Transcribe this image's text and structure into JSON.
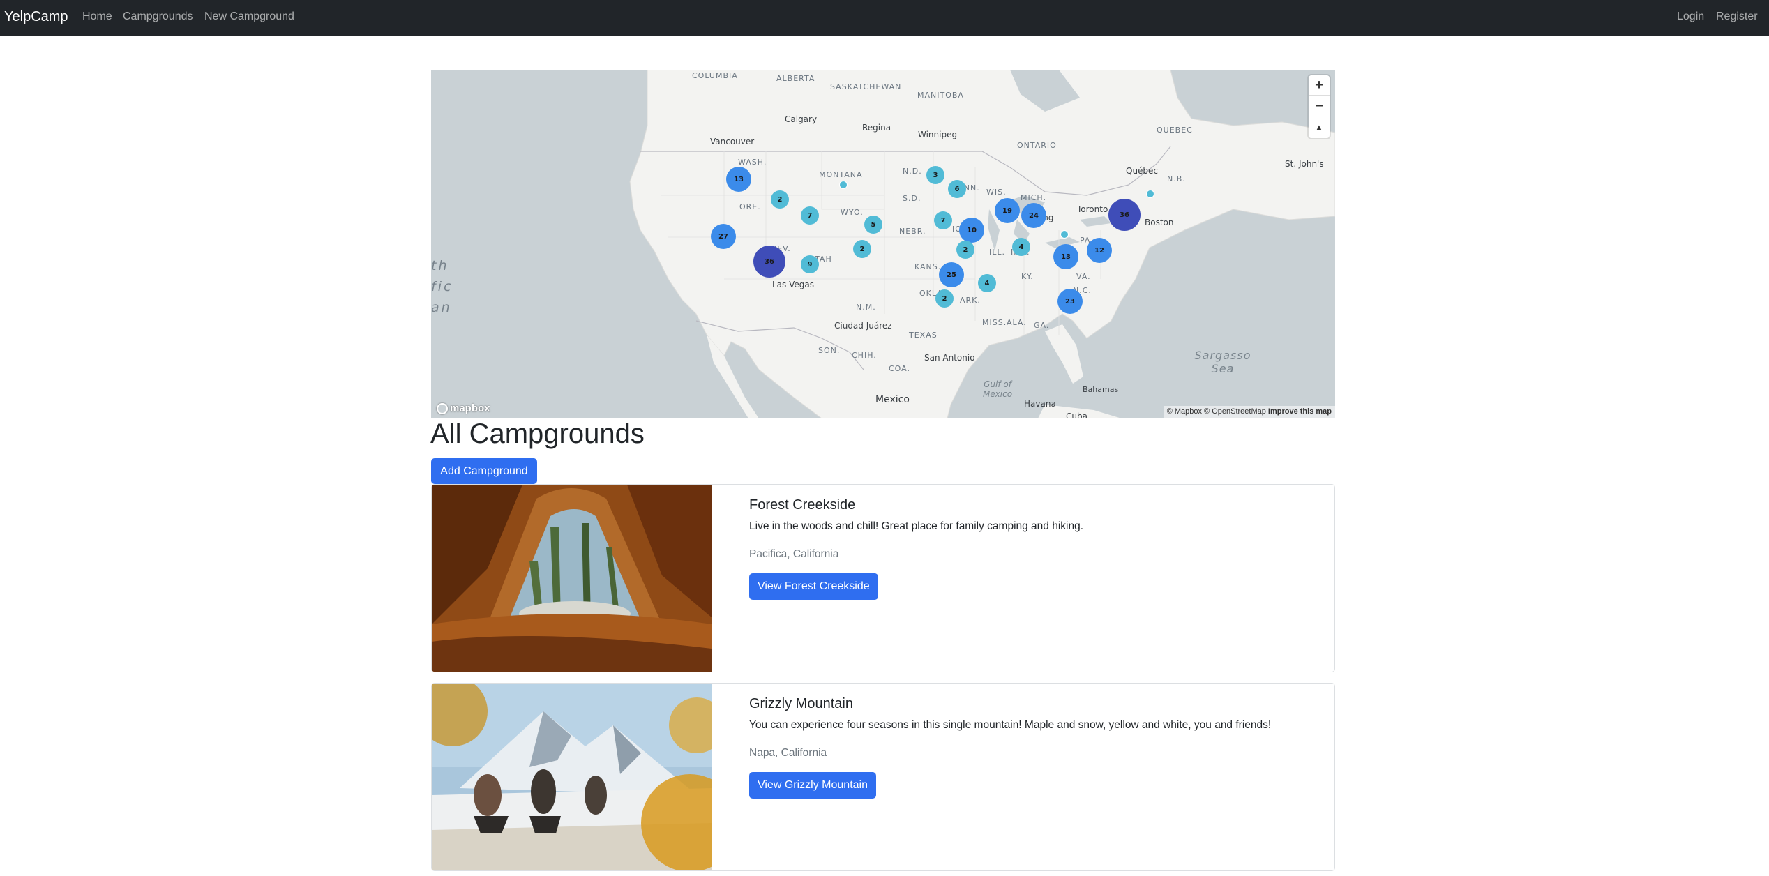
{
  "navbar": {
    "brand": "YelpCamp",
    "links": [
      "Home",
      "Campgrounds",
      "New Campground"
    ],
    "login": "Login",
    "register": "Register"
  },
  "map": {
    "labels": {
      "columbia": "COLUMBIA",
      "alberta": "ALBERTA",
      "saskatchewan": "SASKATCHEWAN",
      "manitoba": "MANITOBA",
      "ontario": "ONTARIO",
      "quebec_region": "QUEBEC",
      "calgary": "Calgary",
      "regina": "Regina",
      "winnipeg": "Winnipeg",
      "vancouver": "Vancouver",
      "wash": "WASH.",
      "montana": "MONTANA",
      "nd": "N.D.",
      "ore": "ORE.",
      "wyo": "WYO.",
      "sd": "S.D.",
      "minn": "MINN.",
      "wis": "WIS.",
      "mich": "MICH.",
      "quebec_city": "Québec",
      "nb": "N.B.",
      "st_johns": "St. John's",
      "toronto": "Toronto",
      "boston": "Boston",
      "lansing": "Lansing",
      "nev": "NEV.",
      "utah": "UTAH",
      "nebr": "NEBR.",
      "iowa": "IOWA",
      "ill": "ILL.",
      "ind": "IND.",
      "pa": "PA.",
      "kans": "KANS.",
      "ky": "KY.",
      "va": "VA.",
      "las_vegas": "Las Vegas",
      "nm": "N.M.",
      "okla": "OKLA.",
      "ark": "ARK.",
      "nc": "N.C.",
      "ciudad_juarez": "Ciudad Juárez",
      "miss": "MISS.",
      "ala": "ALA.",
      "ga": "GA.",
      "texas": "TEXAS",
      "son": "SON.",
      "chih": "CHIH.",
      "san_antonio": "San Antonio",
      "coa": "COA.",
      "mexico": "Mexico",
      "gulf": "Gulf of Mexico",
      "havana": "Havana",
      "cuba": "Cuba",
      "bahamas": "Bahamas",
      "sargasso": "Sargasso Sea",
      "pacific_1": "th",
      "pacific_2": "fic",
      "pacific_3": "an"
    },
    "clusters": [
      {
        "count": "13",
        "tier": "mid"
      },
      {
        "count": "2",
        "tier": "small"
      },
      {
        "count": "7",
        "tier": "small"
      },
      {
        "count": "",
        "tier": "point"
      },
      {
        "count": "27",
        "tier": "mid"
      },
      {
        "count": "36",
        "tier": "large"
      },
      {
        "count": "9",
        "tier": "small"
      },
      {
        "count": "5",
        "tier": "small"
      },
      {
        "count": "2",
        "tier": "small"
      },
      {
        "count": "3",
        "tier": "small"
      },
      {
        "count": "6",
        "tier": "small"
      },
      {
        "count": "7",
        "tier": "small"
      },
      {
        "count": "10",
        "tier": "mid"
      },
      {
        "count": "2",
        "tier": "small"
      },
      {
        "count": "19",
        "tier": "mid"
      },
      {
        "count": "24",
        "tier": "mid"
      },
      {
        "count": "4",
        "tier": "small"
      },
      {
        "count": "",
        "tier": "point"
      },
      {
        "count": "13",
        "tier": "mid"
      },
      {
        "count": "12",
        "tier": "mid"
      },
      {
        "count": "36",
        "tier": "large"
      },
      {
        "count": "",
        "tier": "point"
      },
      {
        "count": "25",
        "tier": "mid"
      },
      {
        "count": "4",
        "tier": "small"
      },
      {
        "count": "2",
        "tier": "small"
      },
      {
        "count": "23",
        "tier": "mid"
      }
    ],
    "zoom_in": "+",
    "zoom_out": "−",
    "compass": "▲",
    "logo": "mapbox",
    "attribution": "© Mapbox © OpenStreetMap",
    "improve": "Improve this map"
  },
  "colors": {
    "navbar_bg": "#212529",
    "primary": "#2f6ef0",
    "cluster_small": "#51bbd6",
    "cluster_mid": "#3b8bea",
    "cluster_large": "#3f4db8"
  },
  "main": {
    "title": "All Campgrounds",
    "add_button": "Add Campground"
  },
  "campgrounds": [
    {
      "title": "Forest Creekside",
      "description": "Live in the woods and chill! Great place for family camping and hiking.",
      "location": "Pacifica, California",
      "button": "View Forest Creekside"
    },
    {
      "title": "Grizzly Mountain",
      "description": "You can experience four seasons in this single mountain! Maple and snow, yellow and white, you and friends!",
      "location": "Napa, California",
      "button": "View Grizzly Mountain"
    }
  ]
}
